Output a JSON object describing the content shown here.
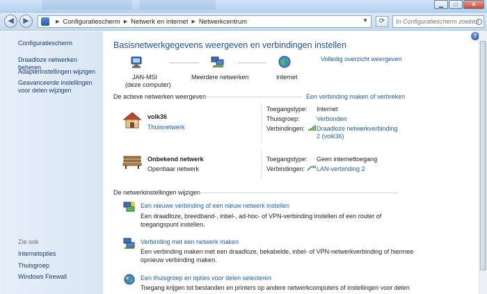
{
  "addressbar": {
    "breadcrumbs": [
      "Configuratiescherm",
      "Netwerk en internet",
      "Netwerkcentrum"
    ],
    "search_placeholder": "In Configuratiescherm zoeken"
  },
  "sidebar": {
    "home": "Configuratiescherm",
    "items": [
      "Draadloze netwerken beheren",
      "Adapterinstellingen wijzigen",
      "Geavanceerde instellingen voor delen wijzigen"
    ],
    "see_also_header": "Zie ook",
    "see_also": [
      "Internetopties",
      "Thuisgroep",
      "Windows Firewall"
    ]
  },
  "main": {
    "title": "Basisnetwerkgegevens weergeven en verbindingen instellen",
    "full_map_link": "Volledig overzicht weergeven",
    "map": {
      "computer_name": "JAN-MSI",
      "computer_sub": "(deze computer)",
      "middle": "Meerdere netwerken",
      "internet": "Internet"
    },
    "active_header": "De actieve netwerken weergeven",
    "connect_link": "Een verbinding maken of verbreken",
    "networks": [
      {
        "name": "volk36",
        "type": "Thuisnetwerk",
        "access_label": "Toegangstype:",
        "access_value": "Internet",
        "homegroup_label": "Thuisgroep:",
        "homegroup_value": "Verbonden",
        "connections_label": "Verbindingen:",
        "connection_line1": "Draadloze netwerkverbinding",
        "connection_line2": "2 (volk36)"
      },
      {
        "name": "Onbekend netwerk",
        "type": "Openbaar netwerk",
        "access_label": "Toegangstype:",
        "access_value": "Geen internettoegang",
        "connections_label": "Verbindingen:",
        "connection_line1": "LAN-verbinding 2"
      }
    ],
    "change_header": "De netwerkinstellingen wijzigen",
    "tasks": [
      {
        "title": "Een nieuwe verbinding of een nieuw netwerk instellen",
        "desc1": "Een draadloze, breedband-, inbel-, ad-hoc- of VPN-verbinding instellen of een router of",
        "desc2": "toegangspunt instellen."
      },
      {
        "title": "Verbinding met een netwerk maken",
        "desc1": "Een verbinding maken met een draadloze, bekabelde, inbel- of VPN-netwerkverbinding of hiermee",
        "desc2": "opnieuw verbinding maken."
      },
      {
        "title": "Een thuisgroep en opties voor delen selecteren",
        "desc1": "Toegang krijgen tot bestanden en printers op andere netwerkcomputers of instellingen voor delen"
      }
    ]
  },
  "colors": {
    "link": "#1b5fad",
    "title": "#1e4e9b",
    "sidebar_bg": "#dce8f5"
  }
}
